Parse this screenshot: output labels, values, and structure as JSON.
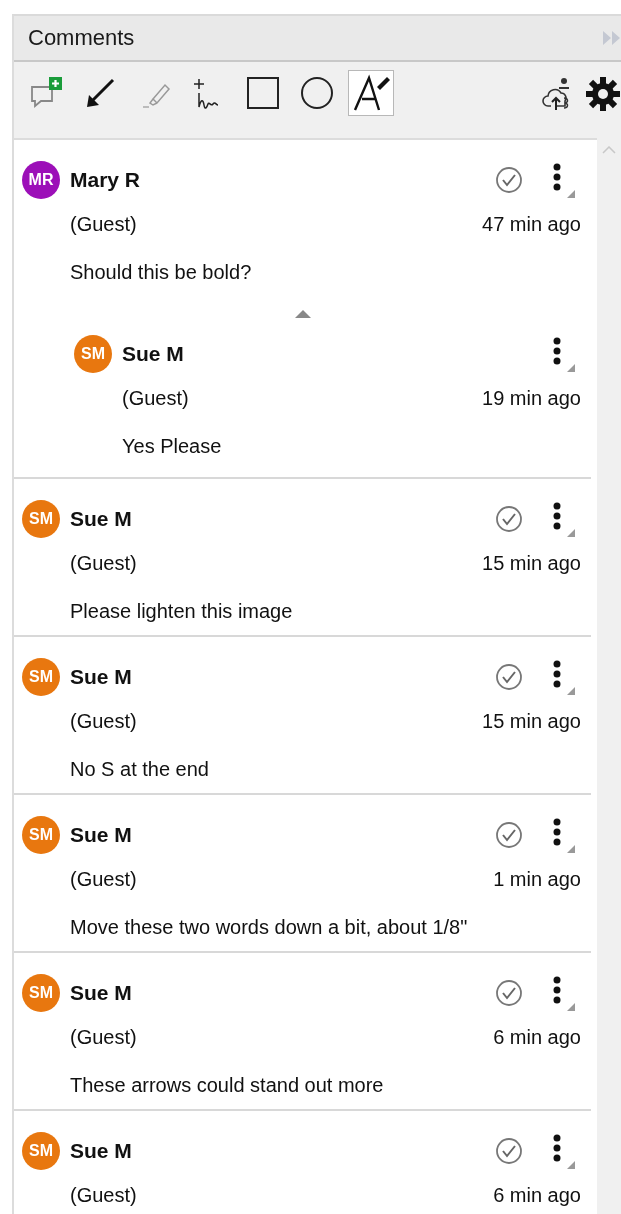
{
  "panel": {
    "title": "Comments"
  },
  "toolbar": {
    "tools": [
      {
        "kind": "add-comment",
        "selected": false
      },
      {
        "kind": "arrow",
        "selected": false
      },
      {
        "kind": "highlighter",
        "selected": false
      },
      {
        "kind": "freehand",
        "selected": false
      },
      {
        "kind": "rectangle",
        "selected": false
      },
      {
        "kind": "ellipse",
        "selected": false
      },
      {
        "kind": "pen",
        "selected": true
      }
    ],
    "actions": [
      {
        "kind": "share"
      },
      {
        "kind": "settings"
      }
    ]
  },
  "comments": [
    {
      "initials": "MR",
      "color": "#9c0fb8",
      "author": "Mary R",
      "role": "(Guest)",
      "time": "47 min ago",
      "text": "Should this be bold?",
      "replies": [
        {
          "initials": "SM",
          "color": "#e8770f",
          "author": "Sue M",
          "role": "(Guest)",
          "time": "19 min ago",
          "text": "Yes Please"
        }
      ]
    },
    {
      "initials": "SM",
      "color": "#e8770f",
      "author": "Sue M",
      "role": "(Guest)",
      "time": "15 min ago",
      "text": "Please lighten this image"
    },
    {
      "initials": "SM",
      "color": "#e8770f",
      "author": "Sue M",
      "role": "(Guest)",
      "time": "15 min ago",
      "text": "No S at the end"
    },
    {
      "initials": "SM",
      "color": "#e8770f",
      "author": "Sue M",
      "role": "(Guest)",
      "time": "1 min ago",
      "text": "Move these two words down a bit, about 1/8\""
    },
    {
      "initials": "SM",
      "color": "#e8770f",
      "author": "Sue M",
      "role": "(Guest)",
      "time": "6 min ago",
      "text": "These arrows could stand out more"
    },
    {
      "initials": "SM",
      "color": "#e8770f",
      "author": "Sue M",
      "role": "(Guest)",
      "time": "6 min ago"
    }
  ]
}
